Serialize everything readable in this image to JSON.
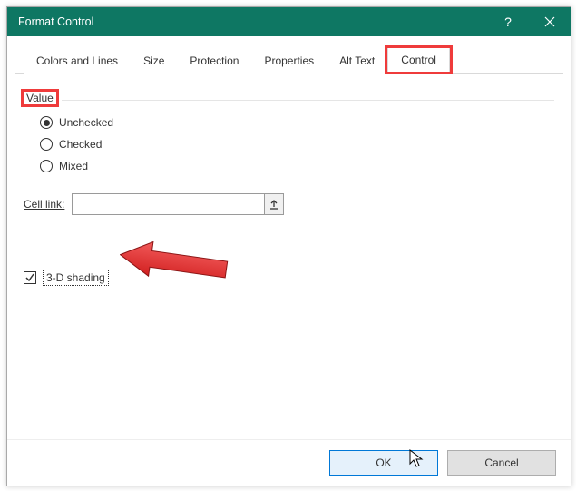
{
  "dialog": {
    "title": "Format Control"
  },
  "tabs": {
    "colors_lines": "Colors and Lines",
    "size": "Size",
    "protection": "Protection",
    "properties": "Properties",
    "alt_text": "Alt Text",
    "control": "Control"
  },
  "group": {
    "value_label": "Value"
  },
  "radios": {
    "unchecked": "Unchecked",
    "checked": "Checked",
    "mixed": "Mixed"
  },
  "cell_link": {
    "label": "Cell link:",
    "value": ""
  },
  "three_d": {
    "label": "3-D shading"
  },
  "buttons": {
    "ok": "OK",
    "cancel": "Cancel"
  }
}
